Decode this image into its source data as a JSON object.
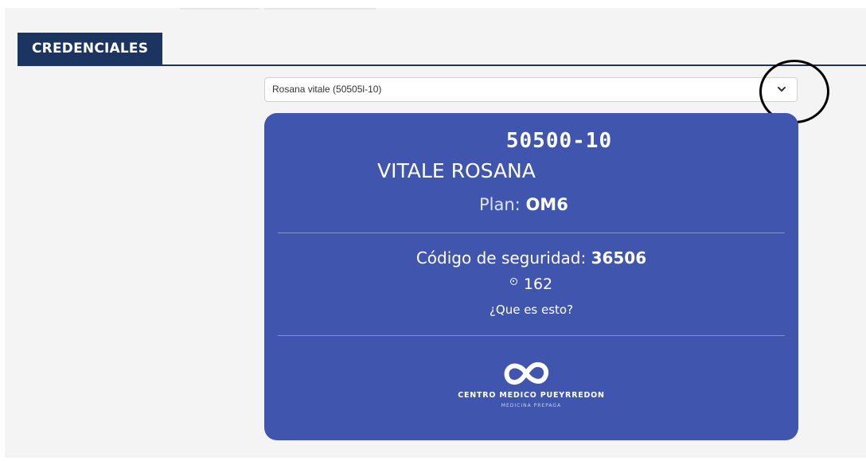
{
  "section": {
    "tab_label": "CREDENCIALES"
  },
  "member_select": {
    "selected_value": "Rosana vitale (50505l-10)",
    "chevron_icon": "chevron-down-icon"
  },
  "credential_card": {
    "member_number": "50500-10",
    "member_name": "VITALE ROSANA",
    "plan_label": "Plan:",
    "plan_value": "OM6",
    "security_label": "Código de seguridad:",
    "security_value": "36506",
    "timer_icon": "timer-icon",
    "timer_value": "162",
    "help_link": "¿Que es esto?",
    "brand_name": "CENTRO MEDICO PUEYRREDON",
    "brand_tagline": "MEDICINA PREPAGA",
    "background_color": "#4056ae"
  },
  "colors": {
    "header_bg": "#1c3560",
    "page_bg": "#f4f4f4"
  }
}
